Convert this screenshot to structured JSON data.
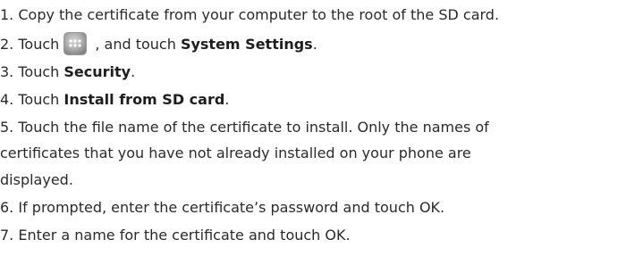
{
  "steps": [
    {
      "prefix": "1. Copy the certificate from your computer to the root of the SD card."
    },
    {
      "prefix": "2. Touch",
      "icon": "all-apps-icon",
      "mid": " , and touch ",
      "bold": "System Settings",
      "suffix": "."
    },
    {
      "prefix": "3. Touch ",
      "bold": "Security",
      "suffix": "."
    },
    {
      "prefix": "4. Touch ",
      "bold": "Install from SD card",
      "suffix": "."
    },
    {
      "lines": [
        "5. Touch the file name of the certificate to install. Only the names of",
        "certificates that you have not already installed on your phone are",
        "displayed."
      ]
    },
    {
      "prefix": "6. If prompted, enter the certificate’s password and touch OK."
    },
    {
      "prefix": "7. Enter a name for the certificate and touch OK."
    }
  ]
}
